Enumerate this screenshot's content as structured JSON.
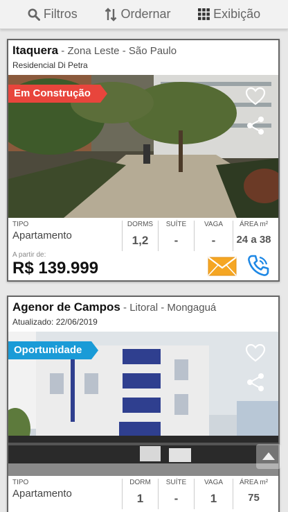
{
  "toolbar": {
    "filters_label": "Filtros",
    "order_label": "Ordernar",
    "view_label": "Exibição"
  },
  "listings": [
    {
      "neighborhood": "Itaquera",
      "region": " - Zona Leste - São Paulo",
      "subtitle": "Residencial Di Petra",
      "badge": "Em Construção",
      "tipo_label": "TIPO",
      "tipo_value": "Apartamento",
      "dorms_label": "DORMS",
      "dorms_value": "1,2",
      "suite_label": "SUÍTE",
      "suite_value": "-",
      "vaga_label": "VAGA",
      "vaga_value": "-",
      "area_label": "ÁREA m²",
      "area_value": "24 a 38",
      "price_prefix": "A partir de:",
      "price": "R$ 139.999"
    },
    {
      "neighborhood": "Agenor de Campos",
      "region": " - Litoral - Mongaguá",
      "subtitle": "Atualizado: 22/06/2019",
      "badge": "Oportunidade",
      "tipo_label": "TIPO",
      "tipo_value": "Apartamento",
      "dorms_label": "DORM",
      "dorms_value": "1",
      "suite_label": "SUÍTE",
      "suite_value": "-",
      "vaga_label": "VAGA",
      "vaga_value": "1",
      "area_label": "ÁREA m²",
      "area_value": "75"
    }
  ],
  "colors": {
    "badge_construction": "#e8453c",
    "badge_opportunity": "#1a9bd7",
    "email_icon": "#f5a623",
    "phone_icon": "#1e88e5"
  },
  "icons": [
    "search-icon",
    "sort-icon",
    "grid-icon",
    "heart-icon",
    "share-icon",
    "email-icon",
    "phone-icon",
    "chevron-up-icon"
  ]
}
